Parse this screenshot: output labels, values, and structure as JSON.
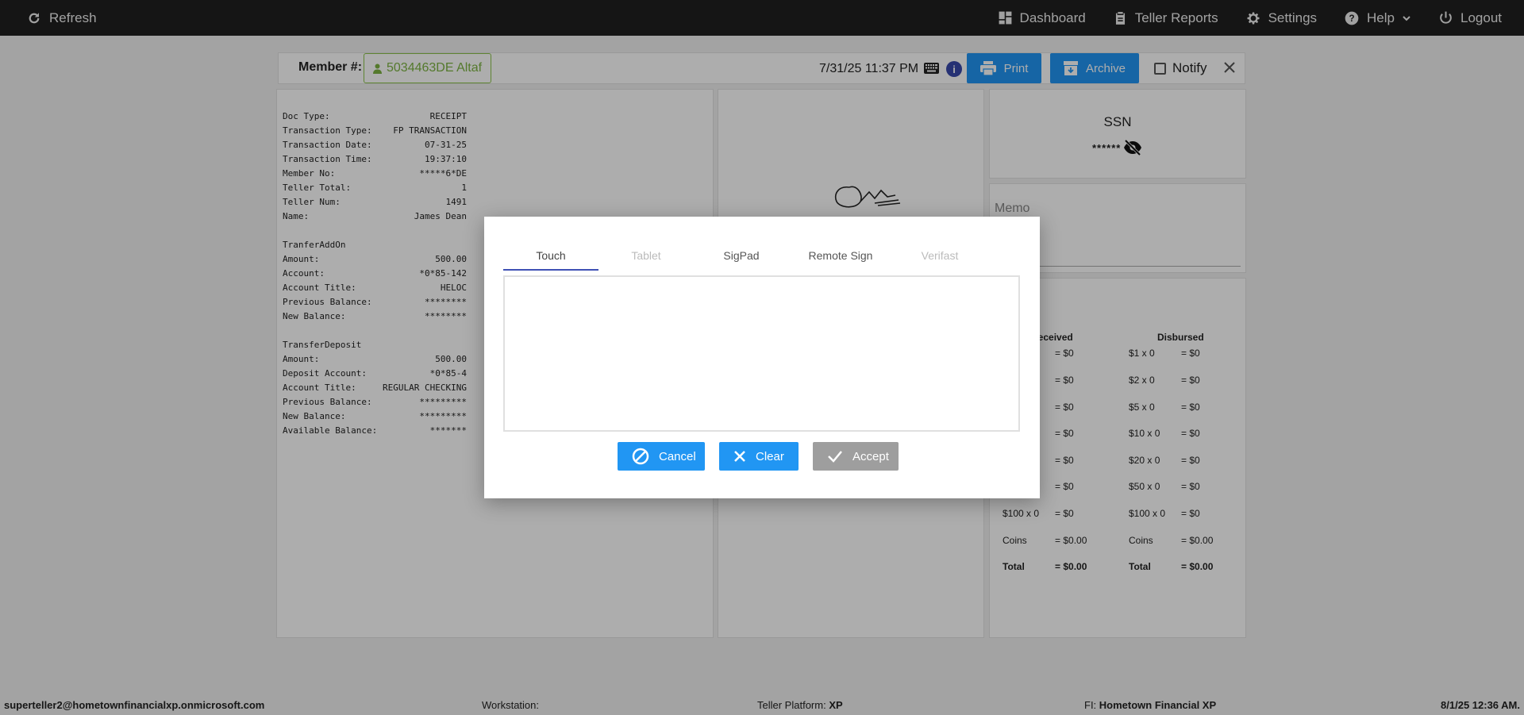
{
  "topnav": {
    "refresh": "Refresh",
    "dashboard": "Dashboard",
    "teller_reports": "Teller Reports",
    "settings": "Settings",
    "help": "Help",
    "logout": "Logout"
  },
  "member_bar": {
    "label": "Member #:",
    "member": "5034463DE Altaf",
    "datetime": "7/31/25 11:37 PM",
    "print": "Print",
    "archive": "Archive",
    "notify": "Notify"
  },
  "receipt": {
    "lines": [
      [
        "Doc Type:",
        "RECEIPT"
      ],
      [
        "Transaction Type:",
        "FP TRANSACTION"
      ],
      [
        "Transaction Date:",
        "07-31-25"
      ],
      [
        "Transaction Time:",
        "19:37:10"
      ],
      [
        "Member No:",
        "*****6*DE"
      ],
      [
        "Teller Total:",
        "1"
      ],
      [
        "Teller Num:",
        "1491"
      ],
      [
        "Name:",
        "James Dean"
      ],
      [
        "",
        ""
      ],
      [
        "TranferAddOn",
        ""
      ],
      [
        "Amount:",
        "500.00"
      ],
      [
        "Account:",
        "*0*85-142"
      ],
      [
        "Account Title:",
        "HELOC"
      ],
      [
        "Previous Balance:",
        "********"
      ],
      [
        "New Balance:",
        "********"
      ],
      [
        "",
        ""
      ],
      [
        "TransferDeposit",
        ""
      ],
      [
        "Amount:",
        "500.00"
      ],
      [
        "Deposit Account:",
        "*0*85-4"
      ],
      [
        "Account Title:",
        "REGULAR CHECKING"
      ],
      [
        "Previous Balance:",
        "*********"
      ],
      [
        "New Balance:",
        "*********"
      ],
      [
        "Available Balance:",
        "*******"
      ]
    ]
  },
  "ssn": {
    "title": "SSN",
    "value": "******"
  },
  "memo": {
    "label": "Memo"
  },
  "cash": {
    "received_header": "Received",
    "disbursed_header": "Disbursed",
    "received": [
      [
        "",
        "= $0"
      ],
      [
        "",
        "= $0"
      ],
      [
        "",
        "= $0"
      ],
      [
        "",
        "= $0"
      ],
      [
        "",
        "= $0"
      ],
      [
        "",
        "= $0"
      ],
      [
        "$100 x 0",
        "= $0"
      ],
      [
        "Coins",
        "= $0.00"
      ],
      [
        "Total",
        "= $0.00"
      ]
    ],
    "disbursed": [
      [
        "$1 x 0",
        "= $0"
      ],
      [
        "$2 x 0",
        "= $0"
      ],
      [
        "$5 x 0",
        "= $0"
      ],
      [
        "$10 x 0",
        "= $0"
      ],
      [
        "$20 x 0",
        "= $0"
      ],
      [
        "$50 x 0",
        "= $0"
      ],
      [
        "$100 x 0",
        "= $0"
      ],
      [
        "Coins",
        "= $0.00"
      ],
      [
        "Total",
        "= $0.00"
      ]
    ]
  },
  "modal": {
    "tabs": [
      {
        "label": "Touch",
        "state": "active"
      },
      {
        "label": "Tablet",
        "state": "disabled"
      },
      {
        "label": "SigPad",
        "state": "enabled"
      },
      {
        "label": "Remote Sign",
        "state": "enabled"
      },
      {
        "label": "Verifast",
        "state": "disabled"
      }
    ],
    "cancel": "Cancel",
    "clear": "Clear",
    "accept": "Accept"
  },
  "statusbar": {
    "user": "superteller2@hometownfinancialxp.onmicrosoft.com",
    "workstation_label": "Workstation:",
    "workstation_value": "",
    "platform_label": "Teller Platform:",
    "platform_value": "XP",
    "fi_label": "FI:",
    "fi_value": "Hometown Financial XP",
    "datetime": "8/1/25 12:36 AM."
  },
  "colors": {
    "primary": "#2196f3",
    "topbar": "#1f1f1f",
    "member_chip": "#7cb342",
    "tab_indicator": "#3f51b5",
    "disabled_button": "#9e9e9e"
  }
}
